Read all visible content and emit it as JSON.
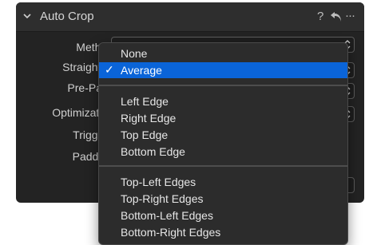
{
  "panel": {
    "title": "Auto Crop",
    "help_glyph": "?",
    "more_glyph": "···",
    "icons": [
      "chevron-down-icon",
      "help-icon",
      "reset-icon",
      "more-icon"
    ],
    "rows": [
      {
        "label": "Method"
      },
      {
        "label": "Straighten"
      },
      {
        "label": "Pre-Pass"
      },
      {
        "label": "Optimization"
      },
      {
        "label": "Triggers"
      },
      {
        "label": "Padding"
      }
    ]
  },
  "menu": {
    "check_glyph": "✓",
    "selected": "Average",
    "groups": [
      [
        "None",
        "Average"
      ],
      [
        "Left Edge",
        "Right Edge",
        "Top Edge",
        "Bottom Edge"
      ],
      [
        "Top-Left Edges",
        "Top-Right Edges",
        "Bottom-Left Edges",
        "Bottom-Right Edges"
      ]
    ]
  },
  "colors": {
    "panel_bg": "#232323",
    "header_bg": "#2e2e2e",
    "menu_bg": "#2c2c2c",
    "selection": "#0a64d8",
    "text": "#e6e6e6"
  }
}
